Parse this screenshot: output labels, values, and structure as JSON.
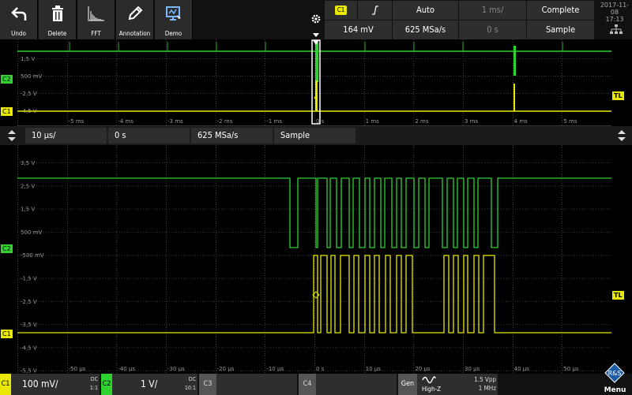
{
  "toolbar": {
    "items": [
      {
        "label": "Undo",
        "icon": "undo-icon"
      },
      {
        "label": "Delete",
        "icon": "trash-icon"
      },
      {
        "label": "FFT",
        "icon": "fft-icon"
      },
      {
        "label": "Annotation",
        "icon": "pencil-icon"
      },
      {
        "label": "Demo",
        "icon": "demo-icon"
      }
    ]
  },
  "trigger": {
    "source": "C1",
    "slope_icon": "rising-edge-icon",
    "mode": "Auto",
    "timebase": "1 ms/",
    "status": "Complete",
    "level": "164 mV",
    "sample_rate": "625 MSa/s",
    "position": "0 s",
    "acquisition": "Sample"
  },
  "datetime": {
    "date": "2017-11-08",
    "time": "17:13"
  },
  "overview": {
    "y_labels": [
      "1,5 V",
      "500 mV",
      "-2,5 V",
      "-4,5 V"
    ],
    "x_labels": [
      "-5 ms",
      "-4 ms",
      "-3 ms",
      "-2 ms",
      "-1 ms",
      "0 s",
      "1 ms",
      "2 ms",
      "3 ms",
      "4 ms",
      "5 ms"
    ],
    "markers": {
      "c2": "C2",
      "c1": "C1",
      "tl": "TL"
    }
  },
  "zoom_bar": {
    "timebase": "10 µs/",
    "position": "0 s",
    "sample_rate": "625 MSa/s",
    "acquisition": "Sample"
  },
  "zoom": {
    "y_labels": [
      "3,5 V",
      "2,5 V",
      "1,5 V",
      "500 mV",
      "-500 mV",
      "-1,5 V",
      "-2,5 V",
      "-3,5 V",
      "-4,5 V",
      "-5,5 V"
    ],
    "x_labels": [
      "-50 µs",
      "-40 µs",
      "-30 µs",
      "-20 µs",
      "-10 µs",
      "0 s",
      "10 µs",
      "20 µs",
      "30 µs",
      "40 µs",
      "50 µs"
    ],
    "markers": {
      "c2": "C2",
      "c1": "C1",
      "tl": "TL"
    }
  },
  "bottom": {
    "c1": {
      "tab": "C1",
      "scale": "100 mV/",
      "coupling": "DC",
      "probe": "1:1"
    },
    "c2": {
      "tab": "C2",
      "scale": "1 V/",
      "coupling": "DC",
      "probe": "10:1"
    },
    "c3": {
      "tab": "C3"
    },
    "c4": {
      "tab": "C4"
    },
    "gen": {
      "label": "Gen",
      "impedance": "High-Z",
      "amplitude": "1.5 Vpp",
      "frequency": "1 MHz",
      "wave_icon": "sine-wave-icon"
    },
    "menu": {
      "label": "Menu",
      "logo": "rs-logo-icon"
    }
  },
  "colors": {
    "ch1": "#e8e800",
    "ch2": "#2fd22f",
    "grid": "#3a3a3a",
    "panel": "#2e2e2e"
  }
}
